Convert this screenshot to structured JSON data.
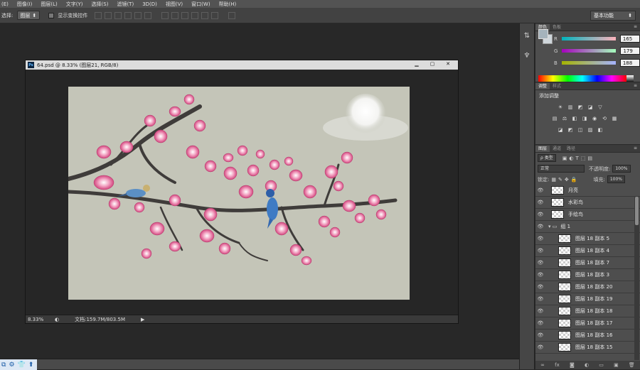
{
  "menu": {
    "items": [
      "(E)",
      "图像(I)",
      "图层(L)",
      "文字(Y)",
      "选择(S)",
      "滤镜(T)",
      "3D(D)",
      "视图(V)",
      "窗口(W)",
      "帮助(H)"
    ]
  },
  "options": {
    "select_label": "选择:",
    "select_value": "图层",
    "checkbox_label": "显示变换控件",
    "workspace": "基本功能"
  },
  "document": {
    "title": "64.psd @ 8.33% (图层21, RGB/8)",
    "zoom": "8.33%",
    "status": "文档:159.7M/803.5M",
    "min": "▁",
    "max": "▢",
    "close": "✕"
  },
  "color_panel": {
    "tabs": [
      "颜色",
      "色板"
    ],
    "r_label": "R",
    "g_label": "G",
    "b_label": "B",
    "r": "165",
    "g": "179",
    "b": "188",
    "fg": "#a5b3bc",
    "bg": "#cfd6db"
  },
  "adjust_panel": {
    "tabs": [
      "调整",
      "样式"
    ],
    "title": "添加调整"
  },
  "layers_panel": {
    "tabs": [
      "图层",
      "通道",
      "路径"
    ],
    "kind": "ρ 类型",
    "blend": "正常",
    "opacity_label": "不透明度:",
    "opacity": "100%",
    "lock_label": "锁定:",
    "fill_label": "填充:",
    "fill": "100%",
    "layers": [
      {
        "name": "月亮",
        "indent": false,
        "folder": false
      },
      {
        "name": "水彩鸟",
        "indent": false,
        "folder": false
      },
      {
        "name": "手绘鸟",
        "indent": false,
        "folder": false
      },
      {
        "name": "组 1",
        "indent": false,
        "folder": true
      },
      {
        "name": "图层 18 副本 5",
        "indent": true,
        "folder": false
      },
      {
        "name": "图层 18 副本 4",
        "indent": true,
        "folder": false
      },
      {
        "name": "图层 18 副本 7",
        "indent": true,
        "folder": false
      },
      {
        "name": "图层 18 副本 3",
        "indent": true,
        "folder": false
      },
      {
        "name": "图层 18 副本 20",
        "indent": true,
        "folder": false
      },
      {
        "name": "图层 18 副本 19",
        "indent": true,
        "folder": false
      },
      {
        "name": "图层 18 副本 18",
        "indent": true,
        "folder": false
      },
      {
        "name": "图层 18 副本 17",
        "indent": true,
        "folder": false
      },
      {
        "name": "图层 18 副本 16",
        "indent": true,
        "folder": false
      },
      {
        "name": "图层 18 副本 15",
        "indent": true,
        "folder": false
      }
    ]
  }
}
